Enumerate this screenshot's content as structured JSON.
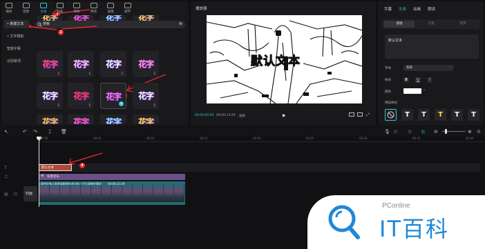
{
  "media_toolbar": {
    "items": [
      {
        "label": "媒体",
        "icon": "media-icon"
      },
      {
        "label": "音频",
        "icon": "audio-icon"
      },
      {
        "label": "文本",
        "icon": "text-icon",
        "active": true
      },
      {
        "label": "贴纸",
        "icon": "sticker-icon"
      },
      {
        "label": "特效",
        "icon": "effects-icon"
      },
      {
        "label": "转场",
        "icon": "transition-icon"
      },
      {
        "label": "滤镜",
        "icon": "filter-icon"
      },
      {
        "label": "调节",
        "icon": "adjust-icon"
      }
    ]
  },
  "text_categories": [
    "• 新建文本",
    "• 文字模板",
    "智能字幕",
    "识别歌词"
  ],
  "search": {
    "query": "搜索"
  },
  "text_tiles": {
    "word": "花字",
    "colors": [
      "#f4d23a",
      "#ff5fa8",
      "#8cf0ff",
      "#ffe03d",
      "#ff4d6d",
      "#ffd0ee",
      "#ffffff",
      "#ff9fd0",
      "#ffffff",
      "#ff3c3c",
      "#ff7bd8",
      "#ffffff"
    ]
  },
  "player": {
    "title": "播放器",
    "overlay_text": "默认文本",
    "time_current": "00:00:00:00",
    "time_total": "00:00:13:29",
    "ratio_label": "画质"
  },
  "inspector": {
    "tabs": [
      "字幕",
      "文本",
      "动画",
      "朗读"
    ],
    "active_tab_index": 1,
    "subtabs": [
      "基础",
      "气泡",
      "花字"
    ],
    "text_value": "默认文本",
    "font_label": "字体",
    "font_value": "系统",
    "style_label": "样式",
    "style_buttons": [
      "B",
      "U",
      "I"
    ],
    "color_label": "颜色",
    "preset_label": "预设样式",
    "presets": [
      {
        "text": "T",
        "color": "#ffffff"
      },
      {
        "text": "T",
        "color": "#ffffff"
      },
      {
        "text": "T",
        "color": "#ffe14a"
      },
      {
        "text": "T",
        "color": "#ffffff"
      },
      {
        "text": "T",
        "color": "#ffffff"
      }
    ]
  },
  "timeline": {
    "ruler_ticks": [
      "00:00",
      "00:05",
      "00:10",
      "00:15",
      "00:20",
      "00:25",
      "00:30",
      "00:35",
      "00:40"
    ],
    "text_clip": "默认文本",
    "audio_clip": "背景音乐",
    "video_clip_label": "周杰伦新人秋阳录影视技术分析一百大演唱会素材",
    "video_clip_duration": "00:00:13:29",
    "cover_label": "封面"
  },
  "annotations": [
    "1",
    "2",
    "3",
    "4"
  ],
  "watermark": {
    "brand": "PConline",
    "title": "IT百科"
  },
  "colors": {
    "accent": "#30c8d6",
    "annotation": "#e8262a",
    "text_clip": "#b0473a",
    "audio_clip": "#6b4f8a",
    "video_clip": "#1f6f73"
  }
}
